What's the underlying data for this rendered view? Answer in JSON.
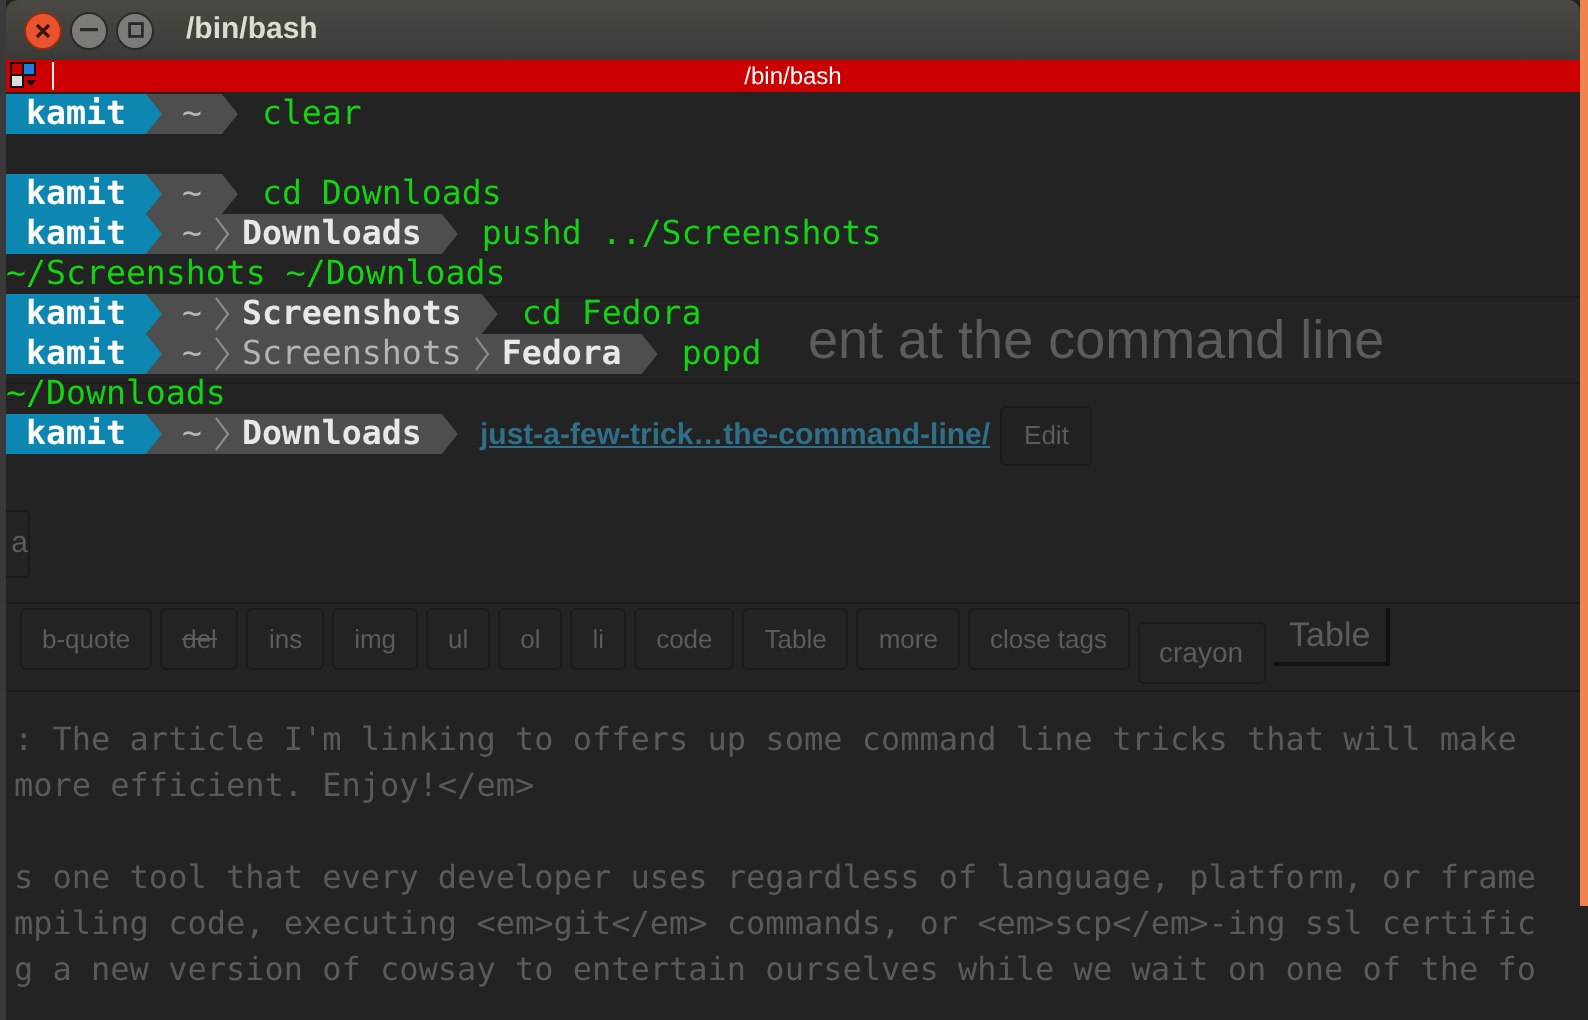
{
  "window": {
    "title": "/bin/bash"
  },
  "tmux_bar": {
    "title": "/bin/bash"
  },
  "terminal": {
    "lines": [
      {
        "kind": "prompt",
        "user": "kamit",
        "path": [
          {
            "kind": "home",
            "text": "~"
          }
        ],
        "command": "clear"
      },
      {
        "kind": "blank"
      },
      {
        "kind": "prompt",
        "user": "kamit",
        "path": [
          {
            "kind": "home",
            "text": "~"
          }
        ],
        "command": "cd Downloads"
      },
      {
        "kind": "prompt",
        "user": "kamit",
        "path": [
          {
            "kind": "home",
            "text": "~"
          },
          {
            "kind": "dir",
            "text": "Downloads",
            "current": true
          }
        ],
        "command": "pushd ../Screenshots"
      },
      {
        "kind": "output",
        "text": "~/Screenshots ~/Downloads"
      },
      {
        "kind": "prompt",
        "user": "kamit",
        "path": [
          {
            "kind": "home",
            "text": "~"
          },
          {
            "kind": "dir",
            "text": "Screenshots",
            "current": true
          }
        ],
        "command": "cd Fedora"
      },
      {
        "kind": "prompt",
        "user": "kamit",
        "path": [
          {
            "kind": "home",
            "text": "~"
          },
          {
            "kind": "dir",
            "text": "Screenshots",
            "current": false
          },
          {
            "kind": "dir",
            "text": "Fedora",
            "current": true
          }
        ],
        "command": "popd"
      },
      {
        "kind": "output",
        "text": "~/Downloads"
      },
      {
        "kind": "prompt",
        "user": "kamit",
        "path": [
          {
            "kind": "home",
            "text": "~"
          },
          {
            "kind": "dir",
            "text": "Downloads",
            "current": true
          }
        ]
      }
    ]
  },
  "background_page": {
    "heading": "ent at the command line",
    "link": "just-a-few-trick…the-command-line/",
    "edit_button": "Edit",
    "side_button": "a",
    "toolbar": [
      {
        "label": "b-quote",
        "kind": "quicktag"
      },
      {
        "label": "del",
        "kind": "strike"
      },
      {
        "label": "ins",
        "kind": "quicktag"
      },
      {
        "label": "img",
        "kind": "quicktag"
      },
      {
        "label": "ul",
        "kind": "quicktag"
      },
      {
        "label": "ol",
        "kind": "quicktag"
      },
      {
        "label": "li",
        "kind": "quicktag"
      },
      {
        "label": "code",
        "kind": "quicktag"
      },
      {
        "label": "Table",
        "kind": "quicktag"
      },
      {
        "label": "more",
        "kind": "quicktag"
      },
      {
        "label": "close tags",
        "kind": "quicktag"
      },
      {
        "label": "crayon",
        "kind": "offset"
      },
      {
        "label": "Table",
        "kind": "large"
      }
    ],
    "editor_paragraphs": [
      [
        ": The article I'm linking to offers up some command line tricks that will make",
        "more efficient. Enjoy!</em>"
      ],
      [
        "s one tool that every developer uses regardless of language, platform, or frame",
        "mpiling code, executing <em>git</em> commands, or <em>scp</em>-ing ssl certific",
        "g a new version of cowsay to entertain ourselves while we wait on one of the fo"
      ]
    ]
  }
}
